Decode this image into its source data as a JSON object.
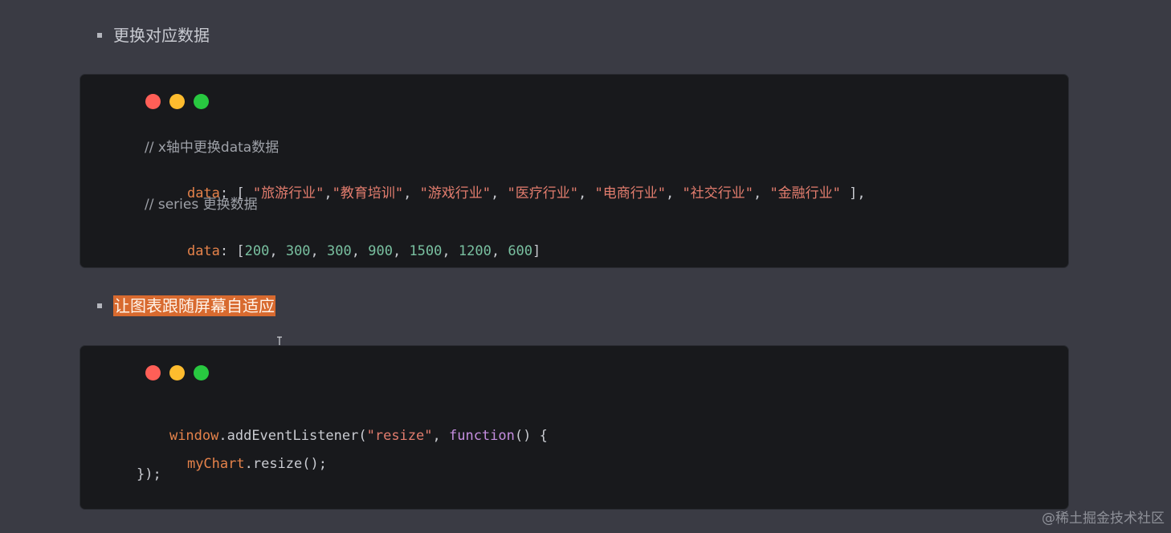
{
  "sections": [
    {
      "heading": "更换对应数据",
      "code": {
        "comment1": "// x轴中更换data数据",
        "line2": {
          "key": "data",
          "colon": ": [ ",
          "items": [
            "\"旅游行业\"",
            ",",
            "\"教育培训\"",
            ", ",
            "\"游戏行业\"",
            ", ",
            "\"医疗行业\"",
            ", ",
            "\"电商行业\"",
            ", ",
            "\"社交行业\"",
            ", ",
            "\"金融行业\"",
            " ],"
          ]
        },
        "comment3": "// series 更换数据",
        "line4": {
          "key": "data",
          "colon": ": [",
          "values": [
            "200",
            "300",
            "300",
            "900",
            "1500",
            "1200",
            "600"
          ],
          "close": "]"
        }
      }
    },
    {
      "heading": "让图表跟随屏幕自适应",
      "code": {
        "line1": {
          "obj": "window",
          "dot": ".addEventListener(",
          "str": "\"resize\"",
          "comma": ", ",
          "fn": "function",
          "rest": "() {"
        },
        "line2": {
          "obj": "myChart",
          "rest": ".resize();"
        },
        "line3": "});"
      }
    }
  ],
  "watermark": "@稀土掘金技术社区",
  "colors": {
    "background": "#3a3b44",
    "code_bg": "#18191c",
    "highlight": "#d86a2f",
    "dot_red": "#ff5f57",
    "dot_yellow": "#febc2e",
    "dot_green": "#28c840"
  }
}
